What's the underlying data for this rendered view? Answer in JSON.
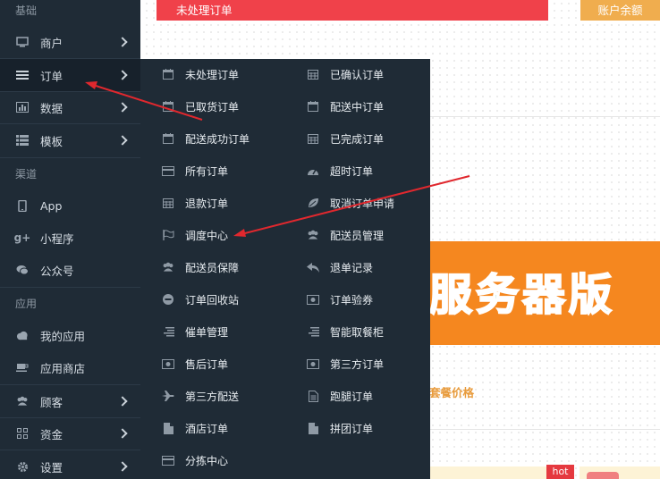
{
  "sidebar": {
    "sections": {
      "basic": "基础",
      "channel": "渠道",
      "apps": "应用"
    },
    "items": [
      {
        "label": "商户",
        "icon": "monitor-icon"
      },
      {
        "label": "订单",
        "icon": "list-icon"
      },
      {
        "label": "数据",
        "icon": "bar-chart-icon"
      },
      {
        "label": "模板",
        "icon": "grid-list-icon"
      },
      {
        "label": "App",
        "icon": "mobile-icon"
      },
      {
        "label": "小程序",
        "icon": "google-plus-icon"
      },
      {
        "label": "公众号",
        "icon": "chat-icon"
      },
      {
        "label": "我的应用",
        "icon": "cloud-icon"
      },
      {
        "label": "应用商店",
        "icon": "coffee-icon"
      },
      {
        "label": "顾客",
        "icon": "users-icon"
      },
      {
        "label": "资金",
        "icon": "qr-grid-icon"
      },
      {
        "label": "设置",
        "icon": "gear-icon"
      }
    ]
  },
  "topbar": {
    "unprocessed": "未处理订单",
    "balance": "账户余额"
  },
  "background": {
    "banner_text": "服务器版",
    "package_price": "套餐价格",
    "hot_badge": "hot"
  },
  "flyout": {
    "left": [
      {
        "label": "未处理订单",
        "icon": "calendar-icon"
      },
      {
        "label": "已取货订单",
        "icon": "calendar-icon"
      },
      {
        "label": "配送成功订单",
        "icon": "calendar-icon"
      },
      {
        "label": "所有订单",
        "icon": "card-icon"
      },
      {
        "label": "退款订单",
        "icon": "calendar-grid-icon"
      },
      {
        "label": "调度中心",
        "icon": "flag-icon"
      },
      {
        "label": "配送员保障",
        "icon": "users-icon"
      },
      {
        "label": "订单回收站",
        "icon": "minus-circle-icon"
      },
      {
        "label": "催单管理",
        "icon": "align-right-icon"
      },
      {
        "label": "售后订单",
        "icon": "money-icon"
      },
      {
        "label": "第三方配送",
        "icon": "plane-icon"
      },
      {
        "label": "酒店订单",
        "icon": "file-icon"
      },
      {
        "label": "分拣中心",
        "icon": "card-icon"
      }
    ],
    "right": [
      {
        "label": "已确认订单",
        "icon": "calendar-grid-icon"
      },
      {
        "label": "配送中订单",
        "icon": "calendar-icon"
      },
      {
        "label": "已完成订单",
        "icon": "calendar-grid-icon"
      },
      {
        "label": "超时订单",
        "icon": "dashboard-icon"
      },
      {
        "label": "取消订单申请",
        "icon": "leaf-icon"
      },
      {
        "label": "配送员管理",
        "icon": "users-icon"
      },
      {
        "label": "退单记录",
        "icon": "reply-icon"
      },
      {
        "label": "订单验券",
        "icon": "money-icon"
      },
      {
        "label": "智能取餐柜",
        "icon": "align-right-icon"
      },
      {
        "label": "第三方订单",
        "icon": "money-icon"
      },
      {
        "label": "跑腿订单",
        "icon": "file-text-icon"
      },
      {
        "label": "拼团订单",
        "icon": "file-icon"
      }
    ]
  },
  "colors": {
    "sidebar_bg": "#1f2b36",
    "red_bar": "#f0414a",
    "gold_bar": "#f0ad4e",
    "arrow": "#e0282e",
    "banner": "#f5871f",
    "banner_text": "#14b598"
  }
}
